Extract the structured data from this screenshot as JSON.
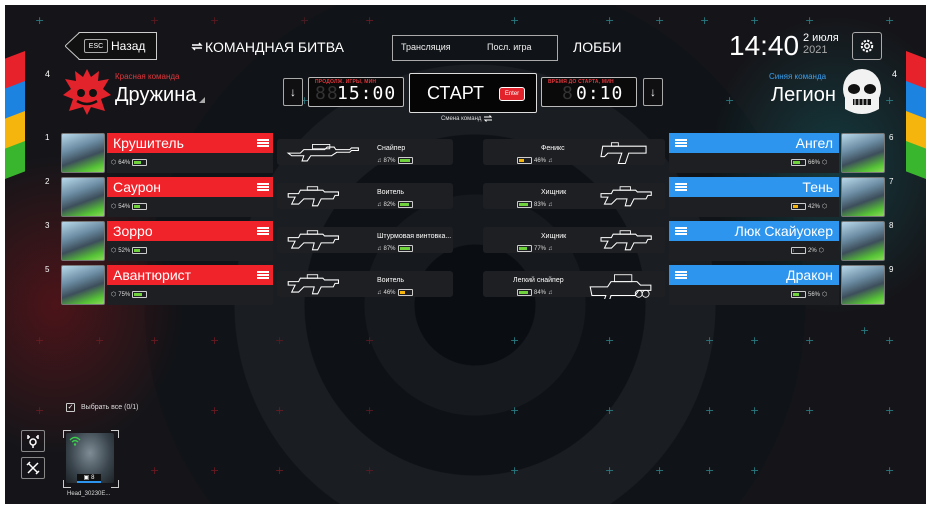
{
  "header": {
    "esc_key": "ESC",
    "back_label": "Назад",
    "mode_label": "КОМАНДНАЯ БИТВА",
    "tab_broadcast": "Трансляция",
    "tab_last_game": "Посл. игра",
    "lobby_label": "ЛОББИ",
    "time": "14:40",
    "date_day": "2 июля",
    "date_year": "2021"
  },
  "red_team": {
    "count": "4",
    "subtitle": "Красная команда",
    "name": "Дружина"
  },
  "blue_team": {
    "count": "4",
    "subtitle": "Синяя команда",
    "name": "Легион"
  },
  "center": {
    "game_time_label": "ПРОДОЛЖ. ИГРЫ, МИН",
    "game_time_ghost": "88",
    "game_time": "15:00",
    "start_label": "СТАРТ",
    "enter_key": "Enter",
    "start_delay_label": "ВРЕМЯ ДО СТАРТА, МИН",
    "start_delay_ghost": "8",
    "start_delay": "0:10",
    "swap_label": "Смена команд"
  },
  "red_players": [
    {
      "num": "1",
      "name": "Крушитель",
      "battery": "64%",
      "battery_level": 0.64,
      "weapon": "Снайпер",
      "weapon_battery": "87%",
      "weapon_level": 0.87
    },
    {
      "num": "2",
      "name": "Саурон",
      "battery": "54%",
      "battery_level": 0.54,
      "weapon": "Воитель",
      "weapon_battery": "82%",
      "weapon_level": 0.82
    },
    {
      "num": "3",
      "name": "Зорро",
      "battery": "52%",
      "battery_level": 0.52,
      "weapon": "Штурмовая винтовка...",
      "weapon_battery": "87%",
      "weapon_level": 0.87
    },
    {
      "num": "5",
      "name": "Авантюрист",
      "battery": "75%",
      "battery_level": 0.75,
      "weapon": "Воитель",
      "weapon_battery": "46%",
      "weapon_level": 0.46
    }
  ],
  "blue_players": [
    {
      "num": "6",
      "name": "Ангел",
      "battery": "66%",
      "battery_level": 0.66,
      "weapon": "Феникс",
      "weapon_battery": "46%",
      "weapon_level": 0.46
    },
    {
      "num": "7",
      "name": "Тень",
      "battery": "42%",
      "battery_level": 0.42,
      "weapon": "Хищник",
      "weapon_battery": "83%",
      "weapon_level": 0.83
    },
    {
      "num": "8",
      "name": "Люк Скайуокер",
      "battery": "2%",
      "battery_level": 0.02,
      "weapon": "Хищник",
      "weapon_battery": "77%",
      "weapon_level": 0.77
    },
    {
      "num": "9",
      "name": "Дракон",
      "battery": "56%",
      "battery_level": 0.56,
      "weapon": "Легкий снайпер",
      "weapon_battery": "84%",
      "weapon_level": 0.84
    }
  ],
  "pool": {
    "select_all": "Выбрать все (0/1)",
    "head_label": "Head_30230E...",
    "head_count": "8"
  },
  "colors": {
    "red": "#f0232b",
    "blue": "#2d95ee",
    "green": "#6fd13b",
    "yellow": "#f5b50d"
  },
  "icons": {
    "settings": "gear-icon",
    "swap": "swap-icon",
    "down": "arrow-down-icon",
    "vest": "armor-icon",
    "gun": "gun-icon"
  }
}
